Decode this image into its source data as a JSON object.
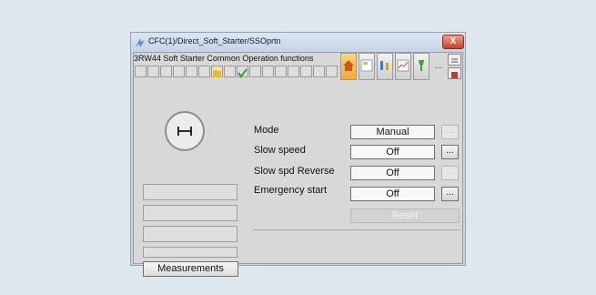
{
  "window": {
    "title": "CFC(1)/Direct_Soft_Starter/SSOprtn",
    "close_label": "X"
  },
  "faceplate": {
    "title": "3RW44 Soft Starter Common Operation functions"
  },
  "toolbar": {
    "more_label": "...",
    "buttons": [
      "home-icon",
      "faceplate-icon",
      "trend-icon",
      "chart-icon",
      "maintenance-icon"
    ]
  },
  "measurements": {
    "label": "Measurements"
  },
  "controls": [
    {
      "label": "Mode",
      "value": "Manual",
      "dots": "...",
      "dots_enabled": false
    },
    {
      "label": "Slow speed",
      "value": "Off",
      "dots": "...",
      "dots_enabled": true
    },
    {
      "label": "Slow spd Reverse",
      "value": "Off",
      "dots": "...",
      "dots_enabled": false
    },
    {
      "label": "Emergency start",
      "value": "Off",
      "dots": "...",
      "dots_enabled": true
    }
  ],
  "reset": {
    "label": "Reset",
    "enabled": false
  },
  "colors": {
    "background": "#dfe7ee",
    "window_frame": "#c6d6e6",
    "close_button": "#c7402a",
    "faceplate": "#d8d8d8"
  }
}
